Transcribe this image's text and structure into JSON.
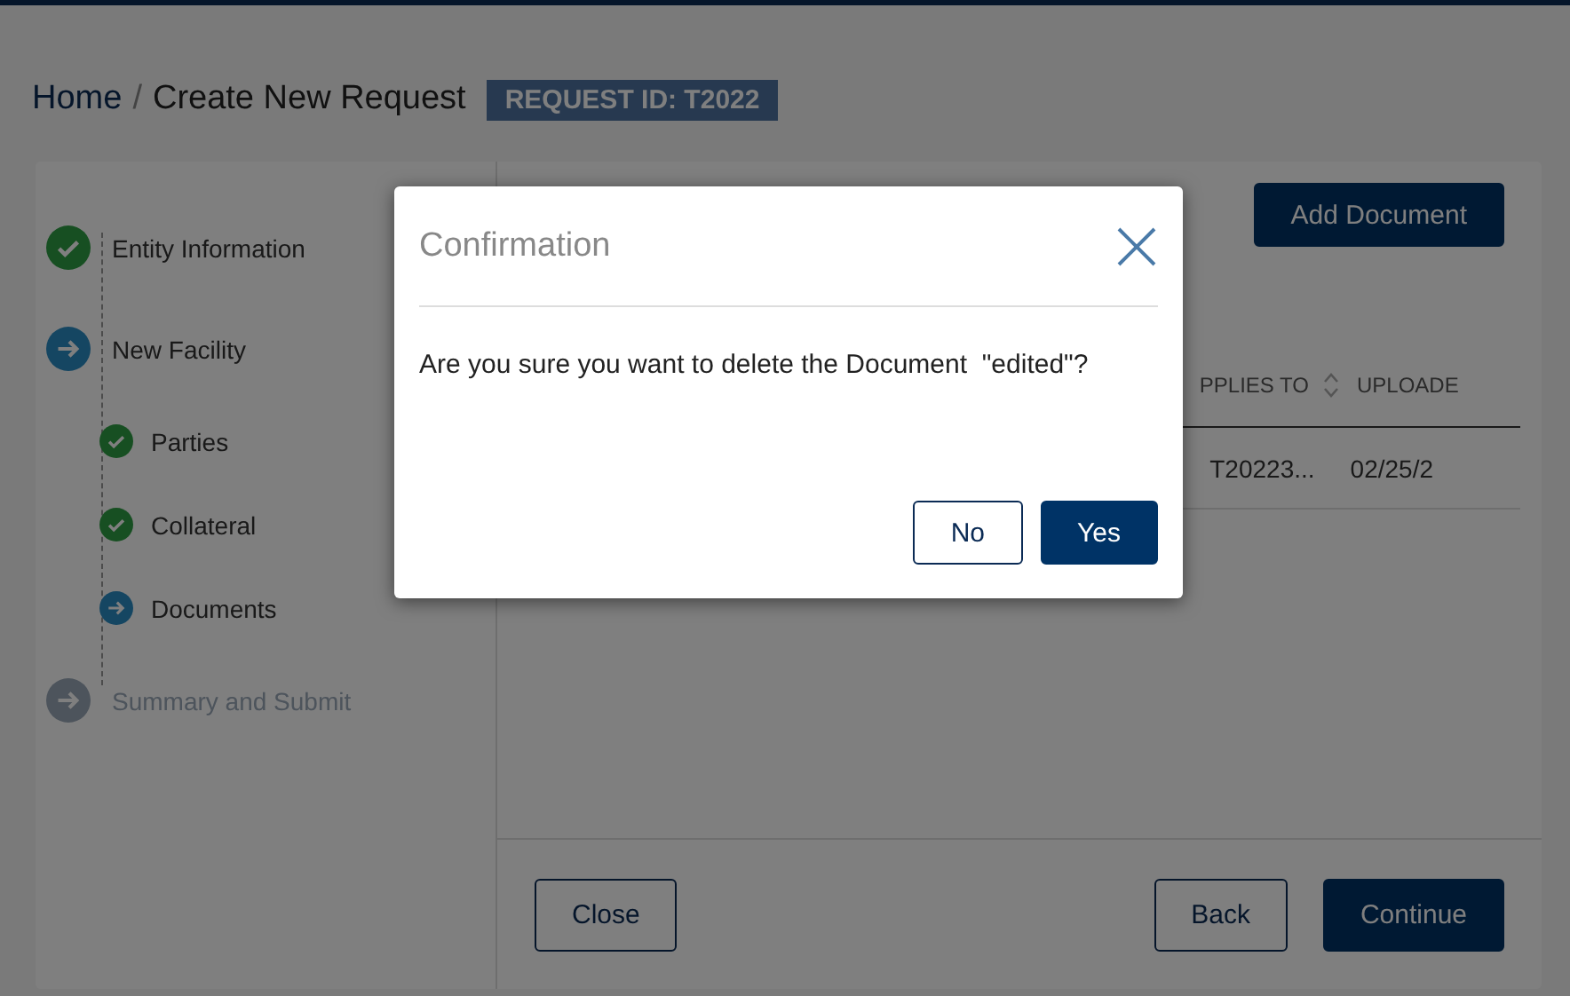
{
  "breadcrumb": {
    "items": [
      "Home",
      "Create New Request"
    ],
    "separator": "/",
    "request_badge": "REQUEST ID: T2022"
  },
  "steps": [
    {
      "label": "Entity Information",
      "kind": "done"
    },
    {
      "label": "New Facility",
      "kind": "current",
      "children": [
        {
          "label": "Parties",
          "kind": "done"
        },
        {
          "label": "Collateral",
          "kind": "done"
        },
        {
          "label": "Documents",
          "kind": "current"
        }
      ]
    },
    {
      "label": "Summary and Submit",
      "kind": "pending"
    }
  ],
  "documents": {
    "add_button": "Add Document",
    "columns": [
      {
        "label": "PPLIES TO",
        "sortable": true
      },
      {
        "label": "UPLOADE",
        "sortable": false
      }
    ],
    "rows": [
      [
        "T20223...",
        "02/25/2"
      ]
    ]
  },
  "footer": {
    "buttons": [
      {
        "label": "Close",
        "kind": "outline"
      },
      {
        "label": "Back",
        "kind": "outline"
      },
      {
        "label": "Continue",
        "kind": "primary"
      }
    ]
  },
  "dialog": {
    "title": "Confirmation",
    "message": "Are you sure you want to delete the Document  \"edited\"?",
    "buttons": [
      {
        "label": "No",
        "kind": "outline"
      },
      {
        "label": "Yes",
        "kind": "primary"
      }
    ]
  }
}
